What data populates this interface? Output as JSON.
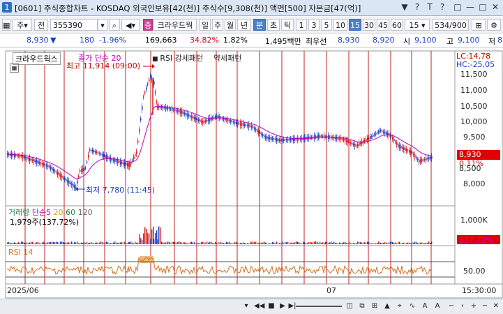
{
  "window": {
    "icon_text": "1",
    "title": "[0601] 주식종합차트 - KOSDAQ 외국인보유[42(천)] 주식수[9,308(천)] 액면[500] 자본금[47(억)]",
    "controls": [
      "▼",
      "?",
      "T",
      "?",
      "□",
      "—",
      "□",
      "✕"
    ]
  },
  "toolbar": {
    "market_select": "주",
    "market_value": "전",
    "code_input": "355390",
    "search_icon": "search-icon",
    "pink_label": "증",
    "stock_name": "크라우드웍",
    "period_tabs": [
      "일",
      "주",
      "월",
      "년",
      "분",
      "초",
      "틱"
    ],
    "period_selected": "분",
    "interval_tabs": [
      "1",
      "3",
      "5",
      "10",
      "15",
      "30",
      "45",
      "60"
    ],
    "interval_selected": "15",
    "interval_combo": "15",
    "page_indicator": "534/900"
  },
  "info_row": {
    "price": "8,930",
    "change_arrow": "▼",
    "change": "180",
    "change_pct": "-1.96%",
    "volume": "169,663",
    "volume_ratio": "34.82%",
    "turnover": "1.82%",
    "amount": "1,495백만",
    "bid_label": "최우선",
    "bid1": "8,930",
    "bid2": "8,920",
    "open_label": "시",
    "open": "9,100",
    "high_label": "고",
    "high": "9,100",
    "low_label": "저",
    "low": "8"
  },
  "price_pane": {
    "legend_name": "크라우드웍스",
    "legend_ma": "종가 단순 20",
    "legend_rsi": "RSI 강세패턴",
    "legend_rsi2": "약세패턴",
    "lc": "LC:14,78",
    "hc": "HC:-25,05",
    "high_annot": "최고 11,914 (09:00)",
    "low_annot": "최저 7,780 (11:45)",
    "ticks": [
      "11,500",
      "11,000",
      "10,500",
      "10,000",
      "9,500",
      "8,000"
    ],
    "current_price_box": "8,930",
    "current_pct": "0.11%",
    "partial_tick": "8,500"
  },
  "volume_pane": {
    "legend_title": "거래량",
    "legend_ma": "단순",
    "ma_values": [
      "5",
      "20",
      "60",
      "120"
    ],
    "volume_text": "1,979주(137.72%)",
    "tick_1000k": "1,000K",
    "current_vol_box": "1,979",
    "current_vol_pct": "137.72%"
  },
  "rsi_pane": {
    "legend": "RSI 14",
    "tick_50": "50.00"
  },
  "x_axis": {
    "label_start": "2025/06",
    "label_mid": "07",
    "label_end": "15:30:00"
  },
  "colors": {
    "candle_up": "#e02020",
    "candle_down": "#2040c0",
    "ma20": "#c000c0",
    "rsi_line": "#d07020",
    "vline": "#c02020",
    "price_box": "#e00000"
  }
}
